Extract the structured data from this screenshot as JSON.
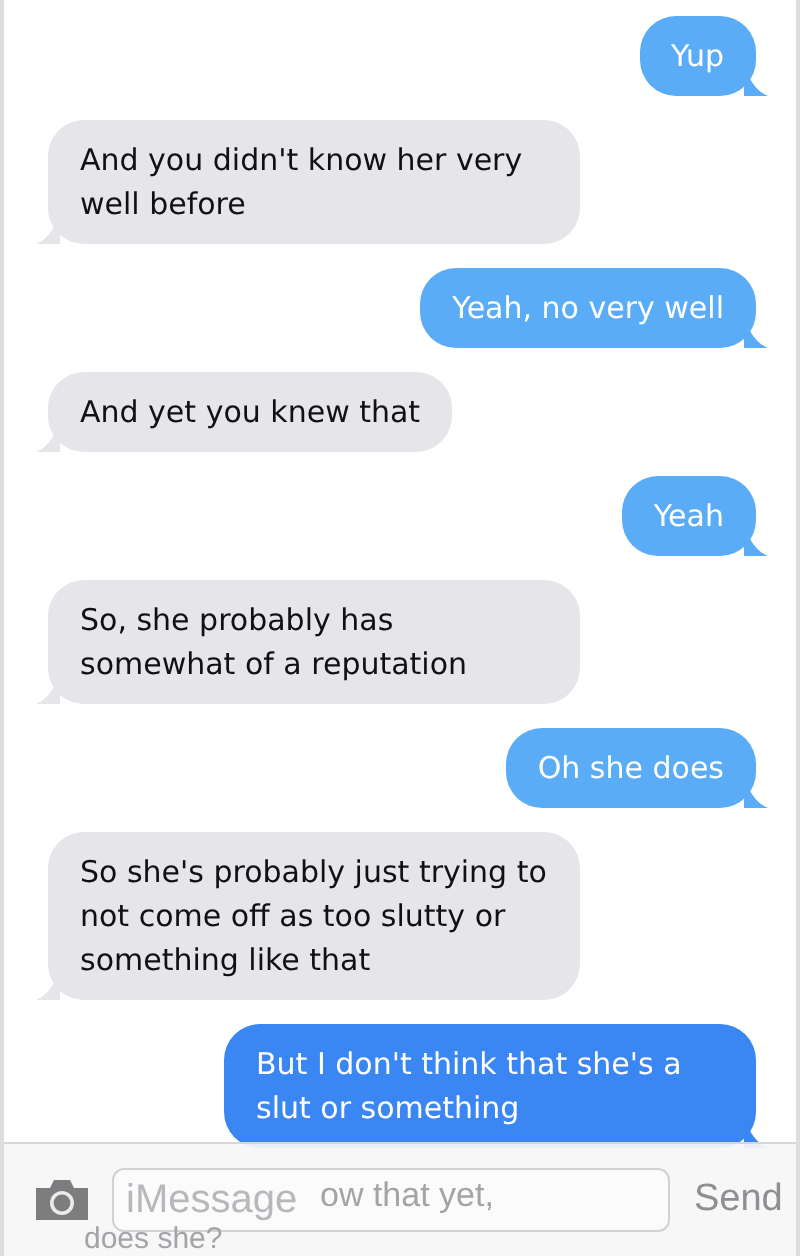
{
  "messages": [
    {
      "kind": "sent",
      "color": "#5aacf6",
      "text": "Yup"
    },
    {
      "kind": "received",
      "color": "#e5e5ea",
      "text": "And you didn't know her very well before"
    },
    {
      "kind": "sent",
      "color": "#5aacf6",
      "text": "Yeah, no very well"
    },
    {
      "kind": "received",
      "color": "#e5e5ea",
      "text": "And yet you knew that"
    },
    {
      "kind": "sent",
      "color": "#5aacf6",
      "text": "Yeah"
    },
    {
      "kind": "received",
      "color": "#e5e5ea",
      "text": "So, she probably has somewhat of a reputation"
    },
    {
      "kind": "sent",
      "color": "#5aacf6",
      "text": "Oh she does"
    },
    {
      "kind": "received",
      "color": "#e5e5ea",
      "text": "So she's probably just trying to not come off as too slutty or something like that"
    },
    {
      "kind": "sent",
      "color": "#3a86f2",
      "text": "But I don't think that she's a slut or something"
    }
  ],
  "covered_message": {
    "lines": [
      "ow that yet,",
      "does she?"
    ]
  },
  "composer": {
    "placeholder": "iMessage",
    "send": "Send"
  }
}
